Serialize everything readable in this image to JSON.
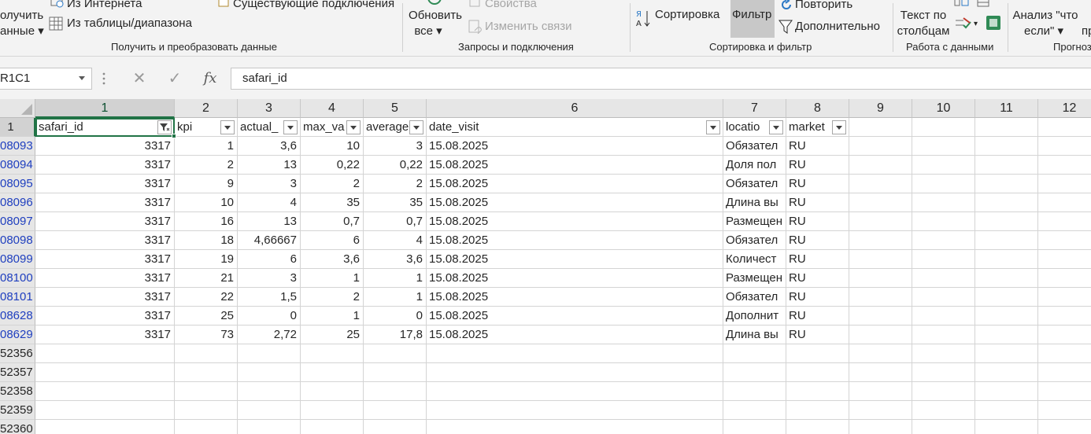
{
  "ribbon": {
    "get_data_label_line1": "олучить",
    "get_data_label_line2": "анные",
    "from_internet": "Из Интернета",
    "from_table": "Из таблицы/диапазона",
    "existing_connections": "Существующие подключения",
    "refresh_line1": "Обновить",
    "refresh_line2": "все",
    "properties": "Свойства",
    "edit_links": "Изменить связи",
    "sort": "Сортировка",
    "filter": "Фильтр",
    "reapply": "Повторить",
    "advanced": "Дополнительно",
    "text_to_columns_line1": "Текст по",
    "text_to_columns_line2": "столбцам",
    "whatif_line1": "Анализ \"что",
    "whatif_line2": "если\"",
    "pr_fragment": "пр",
    "groups": {
      "get_transform": "Получить и преобразовать данные",
      "queries": "Запросы и подключения",
      "sort_filter": "Сортировка и фильтр",
      "data_tools": "Работа с данными",
      "forecast": "Прогноз"
    }
  },
  "formula_bar": {
    "name_box": "R1C1",
    "cancel_icon": "✕",
    "enter_icon": "✓",
    "fx": "fx",
    "content": "safari_id"
  },
  "grid": {
    "columns": [
      "1",
      "2",
      "3",
      "4",
      "5",
      "6",
      "7",
      "8",
      "9",
      "10",
      "11",
      "12"
    ],
    "header_row_number": "1",
    "headers": [
      "safari_id",
      "kpi",
      "actual_",
      "max_va",
      "average",
      "date_visit",
      "locatio",
      "market"
    ],
    "row_numbers": [
      "08093",
      "08094",
      "08095",
      "08096",
      "08097",
      "08098",
      "08099",
      "08100",
      "08101",
      "08628",
      "08629",
      "52356",
      "52357",
      "52358",
      "52359",
      "52360"
    ],
    "rows": [
      [
        "3317",
        "1",
        "3,6",
        "10",
        "3",
        "15.08.2025",
        "Обязател",
        "RU"
      ],
      [
        "3317",
        "2",
        "13",
        "0,22",
        "0,22",
        "15.08.2025",
        "Доля пол",
        "RU"
      ],
      [
        "3317",
        "9",
        "3",
        "2",
        "2",
        "15.08.2025",
        "Обязател",
        "RU"
      ],
      [
        "3317",
        "10",
        "4",
        "35",
        "35",
        "15.08.2025",
        "Длина вы",
        "RU"
      ],
      [
        "3317",
        "16",
        "13",
        "0,7",
        "0,7",
        "15.08.2025",
        "Размещен",
        "RU"
      ],
      [
        "3317",
        "18",
        "4,66667",
        "6",
        "4",
        "15.08.2025",
        "Обязател",
        "RU"
      ],
      [
        "3317",
        "19",
        "6",
        "3,6",
        "3,6",
        "15.08.2025",
        "Количест",
        "RU"
      ],
      [
        "3317",
        "21",
        "3",
        "1",
        "1",
        "15.08.2025",
        "Размещен",
        "RU"
      ],
      [
        "3317",
        "22",
        "1,5",
        "2",
        "1",
        "15.08.2025",
        "Обязател",
        "RU"
      ],
      [
        "3317",
        "25",
        "0",
        "1",
        "0",
        "15.08.2025",
        "Дополнит",
        "RU"
      ],
      [
        "3317",
        "73",
        "2,72",
        "25",
        "17,8",
        "15.08.2025",
        "Длина вы",
        "RU"
      ]
    ]
  },
  "colors": {
    "accent": "#217346",
    "row_link": "#1f3fbf"
  }
}
